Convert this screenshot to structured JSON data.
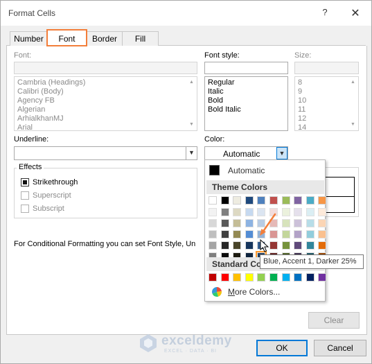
{
  "window": {
    "title": "Format Cells",
    "help_glyph": "?",
    "close_glyph": "✕"
  },
  "tabs": [
    {
      "label": "Number"
    },
    {
      "label": "Font"
    },
    {
      "label": "Border"
    },
    {
      "label": "Fill"
    }
  ],
  "font": {
    "label": "Font:",
    "value": "",
    "items": [
      "Cambria (Headings)",
      "Calibri (Body)",
      "Agency FB",
      "Algerian",
      "ArhialkhanMJ",
      "Arial"
    ]
  },
  "font_style": {
    "label": "Font style:",
    "value": "",
    "items": [
      "Regular",
      "Italic",
      "Bold",
      "Bold Italic"
    ]
  },
  "size": {
    "label": "Size:",
    "value": "",
    "items": [
      "8",
      "9",
      "10",
      "11",
      "12",
      "14"
    ]
  },
  "underline": {
    "label": "Underline:",
    "value": ""
  },
  "color": {
    "label": "Color:",
    "value": "Automatic"
  },
  "effects": {
    "title": "Effects",
    "items": [
      {
        "label": "Strikethrough",
        "checked": true
      },
      {
        "label": "Superscript",
        "checked": false
      },
      {
        "label": "Subscript",
        "checked": false
      }
    ]
  },
  "info_text": "For Conditional Formatting you can set Font Style, Un",
  "color_popup": {
    "automatic_label": "Automatic",
    "theme_header": "Theme Colors",
    "standard_header": "Standard Col",
    "more_colors": "More Colors...",
    "tooltip": "Blue, Accent 1, Darker 25%",
    "theme_top": [
      "#ffffff",
      "#000000",
      "#e7e6e6",
      "#44546a",
      "#4472c4",
      "#ed7d31",
      "#a5a5a5",
      "#ffc000",
      "#5b9bd5",
      "#70ad47"
    ],
    "theme_top_alt": [
      "#ffffff",
      "#000000",
      "#eeece1",
      "#1f497d",
      "#4f81bd",
      "#c0504d",
      "#9bbb59",
      "#8064a2",
      "#4bacc6",
      "#f79646"
    ],
    "theme_shades": [
      [
        "#f2f2f2",
        "#7f7f7f",
        "#ddd9c3",
        "#c6d9f0",
        "#dbe5f1",
        "#f2dcdb",
        "#ebf1dd",
        "#e5e0ec",
        "#dbeef3",
        "#fdeada"
      ],
      [
        "#d8d8d8",
        "#595959",
        "#c4bd97",
        "#8db3e2",
        "#b8cce4",
        "#e5b9b7",
        "#d7e3bc",
        "#ccc1d9",
        "#b7dde8",
        "#fbd5b5"
      ],
      [
        "#bfbfbf",
        "#3f3f3f",
        "#938953",
        "#548dd4",
        "#95b3d7",
        "#d99694",
        "#c3d69b",
        "#b2a2c7",
        "#92cddc",
        "#fac08f"
      ],
      [
        "#a5a5a5",
        "#262626",
        "#494429",
        "#17365d",
        "#366092",
        "#953734",
        "#76923c",
        "#5f497a",
        "#31859b",
        "#e36c09"
      ],
      [
        "#7f7f7f",
        "#0c0c0c",
        "#1d1b10",
        "#0f243e",
        "#244061",
        "#632423",
        "#4f6128",
        "#3f3151",
        "#205867",
        "#974806"
      ]
    ],
    "standard": [
      "#c00000",
      "#ff0000",
      "#ffc000",
      "#ffff00",
      "#92d050",
      "#00b050",
      "#00b0f0",
      "#0070c0",
      "#002060",
      "#7030a0"
    ],
    "selected_swatch": "Blue, Accent 1, Darker 25%"
  },
  "buttons": {
    "clear": "Clear",
    "ok": "OK",
    "cancel": "Cancel"
  },
  "watermark": {
    "name": "exceldemy",
    "tagline": "EXCEL · DATA · BI"
  },
  "accent_color": "#f37e3a"
}
